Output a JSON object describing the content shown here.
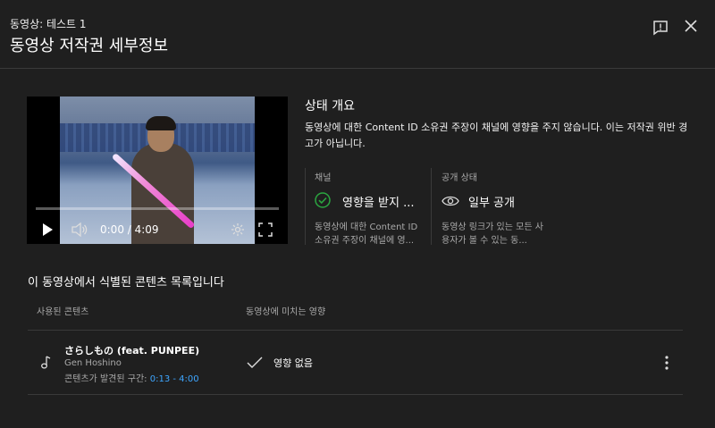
{
  "header": {
    "subtitle": "동영상: 테스트 1",
    "title": "동영상 저작권 세부정보"
  },
  "player": {
    "time": "0:00 / 4:09",
    "progress_fraction": 0
  },
  "status": {
    "title": "상태 개요",
    "description": "동영상에 대한 Content ID 소유권 주장이 채널에 영향을 주지 않습니다. 이는 저작권 위반 경고가 아닙니다.",
    "channel": {
      "label": "채널",
      "value": "영향을 받지 ...",
      "description": "동영상에 대한 Content ID 소유권 주장이 채널에 영..."
    },
    "visibility": {
      "label": "공개 상태",
      "value": "일부 공개",
      "description": "동영상 링크가 있는 모든 사용자가 볼 수 있는 동..."
    }
  },
  "content_list": {
    "title": "이 동영상에서 식별된 콘텐츠 목록입니다",
    "col_used": "사용된 콘텐츠",
    "col_impact": "동영상에 미치는 영향",
    "rows": [
      {
        "title": "さらしもの (feat. PUNPEE)",
        "artist": "Gen Hoshino",
        "range_label": "콘텐츠가 발견된 구간: ",
        "range_value": "0:13 - 4:00",
        "impact": "영향 없음"
      }
    ]
  },
  "colors": {
    "background": "#1f1f1f",
    "accent_link": "#3ea6ff",
    "ok_check": "#2ba640"
  }
}
